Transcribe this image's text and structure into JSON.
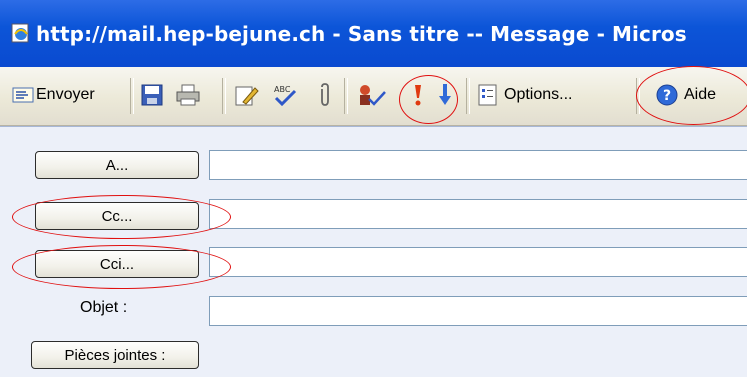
{
  "window": {
    "title": "http://mail.hep-bejune.ch - Sans titre -- Message - Micros",
    "icon": "ie-page-icon"
  },
  "toolbar": {
    "send_label": "Envoyer",
    "options_label": "Options...",
    "help_label": "Aide",
    "icons": [
      "send-icon",
      "save-icon",
      "print-icon",
      "edit-icon",
      "spellcheck-icon",
      "attach-icon",
      "check-names-icon",
      "high-importance-icon",
      "low-importance-icon",
      "options-icon",
      "help-icon"
    ]
  },
  "form": {
    "to_label": "A...",
    "cc_label": "Cc...",
    "bcc_label": "Cci...",
    "subject_label": "Objet :",
    "attachments_label": "Pièces jointes :",
    "to_value": "",
    "cc_value": "",
    "bcc_value": "",
    "subject_value": ""
  },
  "annotations": {
    "highlight_color": "#e01010"
  },
  "colors": {
    "titlebar": "#0c55d8",
    "toolbar": "#ece9d8",
    "form_bg": "#ecf0f9"
  }
}
